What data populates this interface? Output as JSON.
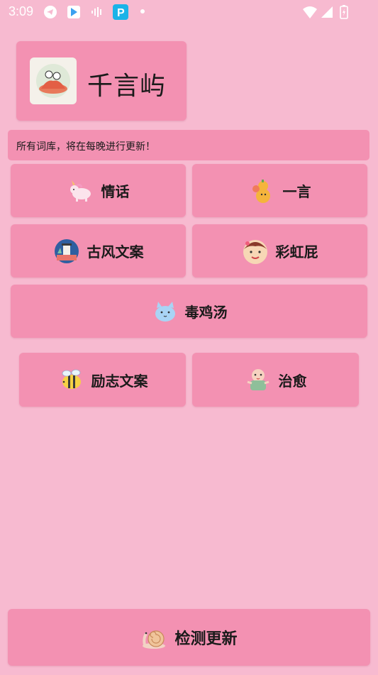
{
  "status_bar": {
    "time": "3:09"
  },
  "header": {
    "app_title": "千言屿"
  },
  "notice": {
    "text": "所有词库，将在每晚进行更新！"
  },
  "categories": [
    {
      "label": "情话",
      "icon": "unicorn-icon"
    },
    {
      "label": "一言",
      "icon": "gourd-icon"
    },
    {
      "label": "古风文案",
      "icon": "pagoda-icon"
    },
    {
      "label": "彩虹屁",
      "icon": "girl-icon"
    },
    {
      "label": "毒鸡汤",
      "icon": "cat-icon"
    },
    {
      "label": "励志文案",
      "icon": "bee-icon"
    },
    {
      "label": "治愈",
      "icon": "baby-icon"
    }
  ],
  "footer": {
    "check_update_label": "检测更新",
    "icon": "snail-icon"
  },
  "colors": {
    "background": "#f7bad0",
    "card": "#f391b2",
    "text": "#1a1a1a"
  }
}
